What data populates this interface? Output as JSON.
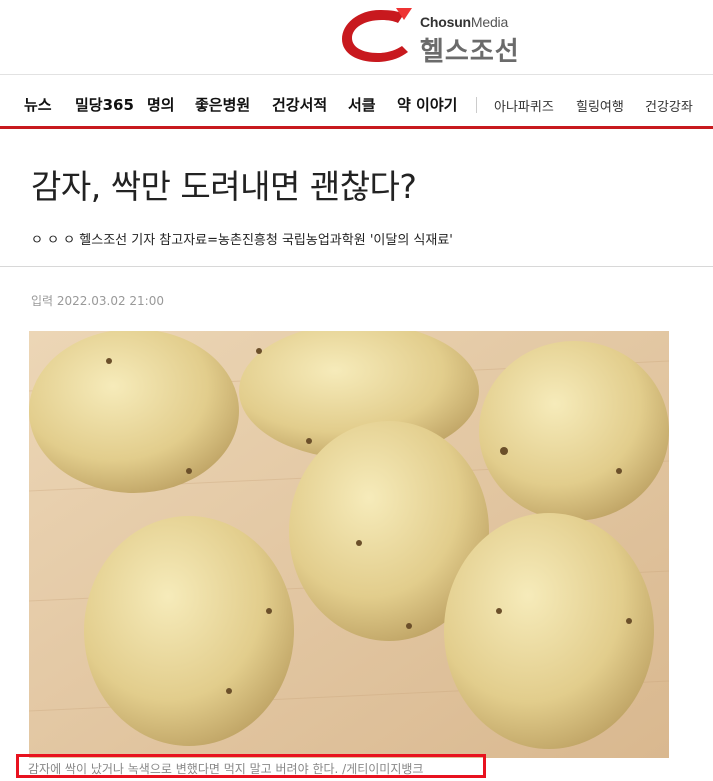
{
  "header": {
    "brand_en_bold": "Chosun",
    "brand_en_light": "Media",
    "brand_kr": "헬스조선"
  },
  "nav": {
    "items": [
      "뉴스",
      "밀당365",
      "명의",
      "좋은병원",
      "건강서적",
      "서클",
      "약 이야기"
    ],
    "secondary": [
      "아나파퀴즈",
      "힐링여행",
      "건강강좌"
    ]
  },
  "article": {
    "title": "감자, 싹만 도려내면 괜찮다?",
    "byline": "ㅇ ㅇ ㅇ 헬스조선 기자 참고자료=농촌진흥청 국립농업과학원 '이달의 식재료'",
    "date": "입력 2022.03.02 21:00",
    "image_alt": "potatoes",
    "caption": "감자에 싹이 났거나 녹색으로 변했다면 먹지 말고 버려야 한다. /게티이미지뱅크"
  },
  "colors": {
    "accent": "#c8191e",
    "highlight_box": "#e8121f"
  }
}
